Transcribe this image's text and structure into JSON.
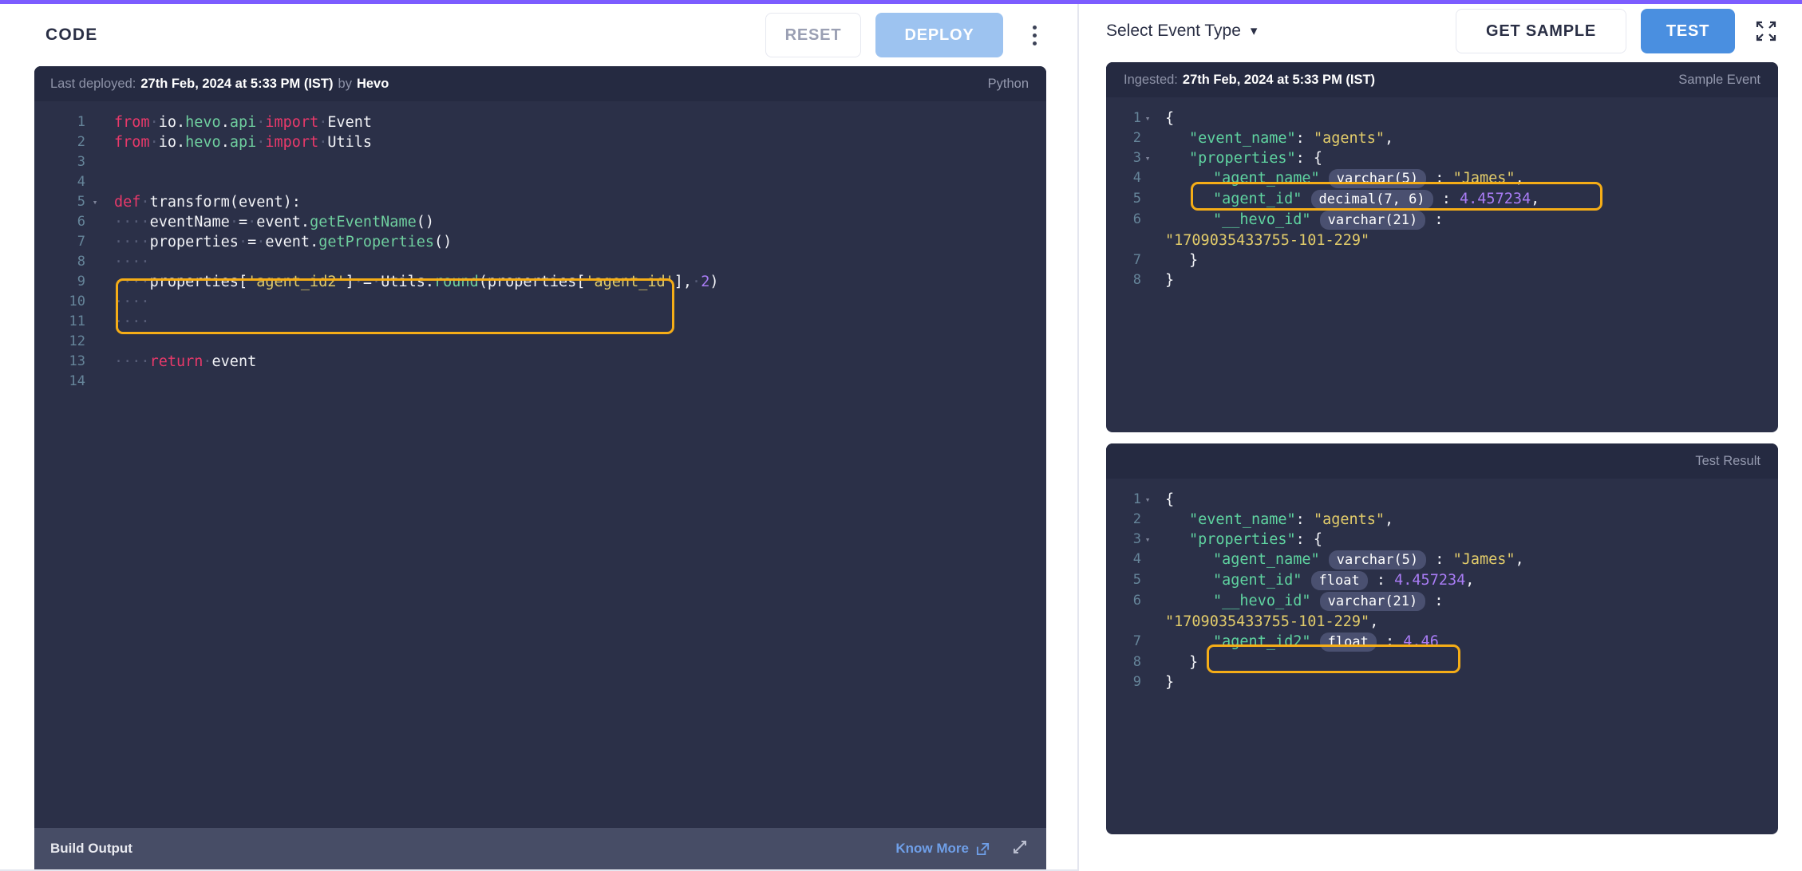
{
  "accent_color": "#7c5cff",
  "left": {
    "title": "CODE",
    "reset_label": "RESET",
    "deploy_label": "DEPLOY",
    "kebab_icon": "more-vertical-icon",
    "editor_bar": {
      "deployed_prefix": "Last deployed:",
      "deployed_time": "27th Feb, 2024 at 5:33 PM (IST)",
      "deployed_by_word": "by",
      "deployed_by": "Hevo",
      "language": "Python"
    },
    "code_lines": [
      {
        "n": "1",
        "fold": "",
        "tokens": [
          {
            "t": "from",
            "c": "kw"
          },
          {
            "t": "·",
            "c": "dot"
          },
          {
            "t": "io.",
            "c": "idn"
          },
          {
            "t": "hevo",
            "c": "mod"
          },
          {
            "t": ".",
            "c": "idn"
          },
          {
            "t": "api",
            "c": "mod"
          },
          {
            "t": "·",
            "c": "dot"
          },
          {
            "t": "import",
            "c": "kw"
          },
          {
            "t": "·",
            "c": "dot"
          },
          {
            "t": "Event",
            "c": "idn"
          }
        ]
      },
      {
        "n": "2",
        "fold": "",
        "tokens": [
          {
            "t": "from",
            "c": "kw"
          },
          {
            "t": "·",
            "c": "dot"
          },
          {
            "t": "io.",
            "c": "idn"
          },
          {
            "t": "hevo",
            "c": "mod"
          },
          {
            "t": ".",
            "c": "idn"
          },
          {
            "t": "api",
            "c": "mod"
          },
          {
            "t": "·",
            "c": "dot"
          },
          {
            "t": "import",
            "c": "kw"
          },
          {
            "t": "·",
            "c": "dot"
          },
          {
            "t": "Utils",
            "c": "idn"
          }
        ]
      },
      {
        "n": "3",
        "fold": "",
        "tokens": []
      },
      {
        "n": "4",
        "fold": "",
        "tokens": []
      },
      {
        "n": "5",
        "fold": "▾",
        "tokens": [
          {
            "t": "def",
            "c": "kw"
          },
          {
            "t": "·",
            "c": "dot"
          },
          {
            "t": "transform(event):",
            "c": "idn"
          }
        ]
      },
      {
        "n": "6",
        "fold": "",
        "tokens": [
          {
            "t": "····",
            "c": "dot"
          },
          {
            "t": "eventName",
            "c": "idn"
          },
          {
            "t": "·",
            "c": "dot"
          },
          {
            "t": "=",
            "c": "idn"
          },
          {
            "t": "·",
            "c": "dot"
          },
          {
            "t": "event.",
            "c": "idn"
          },
          {
            "t": "getEventName",
            "c": "fn"
          },
          {
            "t": "()",
            "c": "idn"
          }
        ]
      },
      {
        "n": "7",
        "fold": "",
        "tokens": [
          {
            "t": "····",
            "c": "dot"
          },
          {
            "t": "properties",
            "c": "idn"
          },
          {
            "t": "·",
            "c": "dot"
          },
          {
            "t": "=",
            "c": "idn"
          },
          {
            "t": "·",
            "c": "dot"
          },
          {
            "t": "event.",
            "c": "idn"
          },
          {
            "t": "getProperties",
            "c": "fn"
          },
          {
            "t": "()",
            "c": "idn"
          }
        ]
      },
      {
        "n": "8",
        "fold": "",
        "tokens": [
          {
            "t": "····",
            "c": "dot"
          }
        ]
      },
      {
        "n": "9",
        "fold": "",
        "tokens": [
          {
            "t": "····",
            "c": "dot"
          },
          {
            "t": "properties[",
            "c": "idn"
          },
          {
            "t": "'agent_id2'",
            "c": "str"
          },
          {
            "t": "]",
            "c": "idn"
          },
          {
            "t": "·",
            "c": "dot"
          },
          {
            "t": "=",
            "c": "idn"
          },
          {
            "t": "·",
            "c": "dot"
          },
          {
            "t": "Utils.",
            "c": "idn"
          },
          {
            "t": "round",
            "c": "fn"
          },
          {
            "t": "(properties[",
            "c": "idn"
          },
          {
            "t": "'agent_id'",
            "c": "str"
          },
          {
            "t": "],",
            "c": "idn"
          },
          {
            "t": "·",
            "c": "dot"
          },
          {
            "t": "2",
            "c": "num"
          },
          {
            "t": ")",
            "c": "idn"
          }
        ]
      },
      {
        "n": "10",
        "fold": "",
        "tokens": [
          {
            "t": "····",
            "c": "dot"
          }
        ]
      },
      {
        "n": "11",
        "fold": "",
        "tokens": [
          {
            "t": "····",
            "c": "dot"
          }
        ]
      },
      {
        "n": "12",
        "fold": "",
        "tokens": []
      },
      {
        "n": "13",
        "fold": "",
        "tokens": [
          {
            "t": "····",
            "c": "dot"
          },
          {
            "t": "return",
            "c": "kw"
          },
          {
            "t": "·",
            "c": "dot"
          },
          {
            "t": "event",
            "c": "idn"
          }
        ]
      },
      {
        "n": "14",
        "fold": "",
        "tokens": []
      }
    ],
    "footer": {
      "build_output": "Build Output",
      "know_more": "Know More",
      "external_link_icon": "external-link-icon",
      "expand_icon": "expand-icon"
    }
  },
  "right": {
    "select_event_label": "Select Event Type",
    "chevron_icon": "chevron-down-icon",
    "get_sample_label": "GET SAMPLE",
    "test_label": "TEST",
    "fullscreen_icon": "fullscreen-icon",
    "sample": {
      "ingested_prefix": "Ingested:",
      "ingested_time": "27th Feb, 2024 at 5:33 PM (IST)",
      "panel_label": "Sample Event",
      "lines": [
        {
          "n": "1",
          "fold": "▾",
          "indent": 0,
          "tokens": [
            {
              "t": "{",
              "c": "jpunc"
            }
          ]
        },
        {
          "n": "2",
          "fold": "",
          "indent": 1,
          "tokens": [
            {
              "t": "\"event_name\"",
              "c": "jkey"
            },
            {
              "t": ": ",
              "c": "jpunc"
            },
            {
              "t": "\"agents\"",
              "c": "jstr"
            },
            {
              "t": ",",
              "c": "jpunc"
            }
          ]
        },
        {
          "n": "3",
          "fold": "▾",
          "indent": 1,
          "tokens": [
            {
              "t": "\"properties\"",
              "c": "jkey"
            },
            {
              "t": ": {",
              "c": "jpunc"
            }
          ]
        },
        {
          "n": "4",
          "fold": "",
          "indent": 2,
          "tokens": [
            {
              "t": "\"agent_name\"",
              "c": "jkey"
            },
            {
              "t": " ",
              "c": "jpunc"
            },
            {
              "t": "varchar(5)",
              "c": "badge"
            },
            {
              "t": " : ",
              "c": "jpunc"
            },
            {
              "t": "\"James\"",
              "c": "jstr"
            },
            {
              "t": ",",
              "c": "jpunc"
            }
          ]
        },
        {
          "n": "5",
          "fold": "",
          "indent": 2,
          "tokens": [
            {
              "t": "\"agent_id\"",
              "c": "jkey"
            },
            {
              "t": " ",
              "c": "jpunc"
            },
            {
              "t": "decimal(7, 6)",
              "c": "badge"
            },
            {
              "t": " : ",
              "c": "jpunc"
            },
            {
              "t": "4.457234",
              "c": "jnum"
            },
            {
              "t": ",",
              "c": "jpunc"
            }
          ]
        },
        {
          "n": "6",
          "fold": "",
          "indent": 2,
          "tokens": [
            {
              "t": "\"__hevo_id\"",
              "c": "jkey"
            },
            {
              "t": " ",
              "c": "jpunc"
            },
            {
              "t": "varchar(21)",
              "c": "badge"
            },
            {
              "t": " : ",
              "c": "jpunc"
            }
          ]
        },
        {
          "n": "",
          "fold": "",
          "indent": 0,
          "tokens": [
            {
              "t": "\"1709035433755-101-229\"",
              "c": "jstr"
            }
          ]
        },
        {
          "n": "7",
          "fold": "",
          "indent": 1,
          "tokens": [
            {
              "t": "}",
              "c": "jpunc"
            }
          ]
        },
        {
          "n": "8",
          "fold": "",
          "indent": 0,
          "tokens": [
            {
              "t": "}",
              "c": "jpunc"
            }
          ]
        }
      ]
    },
    "result": {
      "panel_label": "Test Result",
      "lines": [
        {
          "n": "1",
          "fold": "▾",
          "indent": 0,
          "tokens": [
            {
              "t": "{",
              "c": "jpunc"
            }
          ]
        },
        {
          "n": "2",
          "fold": "",
          "indent": 1,
          "tokens": [
            {
              "t": "\"event_name\"",
              "c": "jkey"
            },
            {
              "t": ": ",
              "c": "jpunc"
            },
            {
              "t": "\"agents\"",
              "c": "jstr"
            },
            {
              "t": ",",
              "c": "jpunc"
            }
          ]
        },
        {
          "n": "3",
          "fold": "▾",
          "indent": 1,
          "tokens": [
            {
              "t": "\"properties\"",
              "c": "jkey"
            },
            {
              "t": ": {",
              "c": "jpunc"
            }
          ]
        },
        {
          "n": "4",
          "fold": "",
          "indent": 2,
          "tokens": [
            {
              "t": "\"agent_name\"",
              "c": "jkey"
            },
            {
              "t": " ",
              "c": "jpunc"
            },
            {
              "t": "varchar(5)",
              "c": "badge"
            },
            {
              "t": " : ",
              "c": "jpunc"
            },
            {
              "t": "\"James\"",
              "c": "jstr"
            },
            {
              "t": ",",
              "c": "jpunc"
            }
          ]
        },
        {
          "n": "5",
          "fold": "",
          "indent": 2,
          "tokens": [
            {
              "t": "\"agent_id\"",
              "c": "jkey"
            },
            {
              "t": " ",
              "c": "jpunc"
            },
            {
              "t": "float",
              "c": "badge"
            },
            {
              "t": " : ",
              "c": "jpunc"
            },
            {
              "t": "4.457234",
              "c": "jnum"
            },
            {
              "t": ",",
              "c": "jpunc"
            }
          ]
        },
        {
          "n": "6",
          "fold": "",
          "indent": 2,
          "tokens": [
            {
              "t": "\"__hevo_id\"",
              "c": "jkey"
            },
            {
              "t": " ",
              "c": "jpunc"
            },
            {
              "t": "varchar(21)",
              "c": "badge"
            },
            {
              "t": " : ",
              "c": "jpunc"
            }
          ]
        },
        {
          "n": "",
          "fold": "",
          "indent": 0,
          "tokens": [
            {
              "t": "\"1709035433755-101-229\"",
              "c": "jstr"
            },
            {
              "t": ",",
              "c": "jpunc"
            }
          ]
        },
        {
          "n": "7",
          "fold": "",
          "indent": 2,
          "tokens": [
            {
              "t": "\"agent_id2\"",
              "c": "jkey"
            },
            {
              "t": " ",
              "c": "jpunc"
            },
            {
              "t": "float",
              "c": "badge"
            },
            {
              "t": " : ",
              "c": "jpunc"
            },
            {
              "t": "4.46",
              "c": "jnum"
            }
          ]
        },
        {
          "n": "8",
          "fold": "",
          "indent": 1,
          "tokens": [
            {
              "t": "}",
              "c": "jpunc"
            }
          ]
        },
        {
          "n": "9",
          "fold": "",
          "indent": 0,
          "tokens": [
            {
              "t": "}",
              "c": "jpunc"
            }
          ]
        }
      ]
    }
  }
}
